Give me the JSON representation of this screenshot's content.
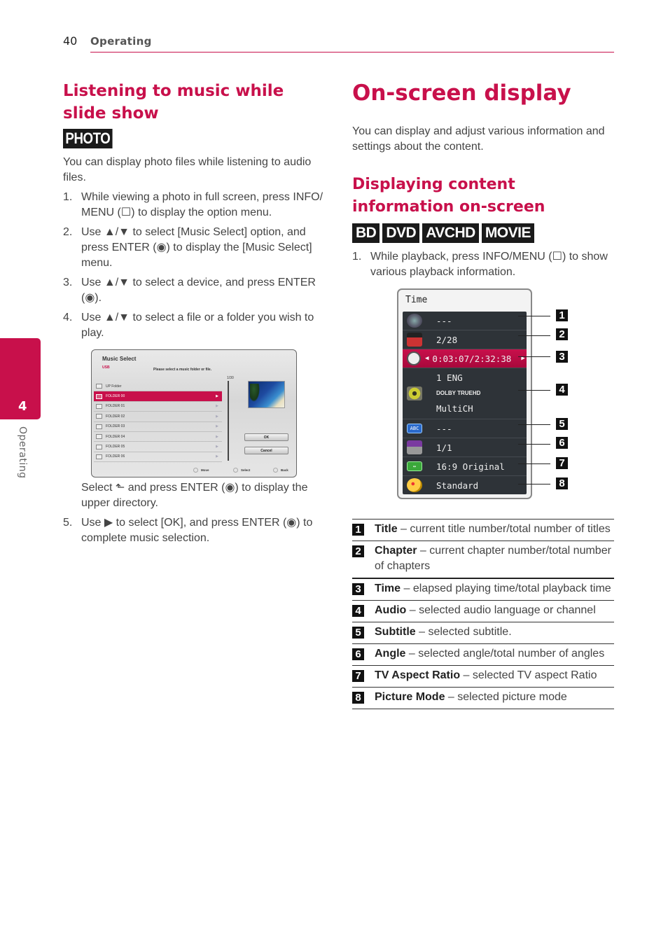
{
  "header": {
    "page_number": "40",
    "section": "Operating"
  },
  "side_tab": {
    "chapter_number": "4",
    "label": "Operating"
  },
  "left": {
    "heading": "Listening to music while slide show",
    "badge": "PHOTO",
    "intro": "You can display photo files while listening to audio files.",
    "steps": [
      {
        "num": "1.",
        "text": "While viewing a photo in full screen, press INFO/ MENU (☐) to display the option menu."
      },
      {
        "num": "2.",
        "text": "Use ▲/▼ to select [Music Select] option, and press ENTER (◉) to display the [Music Select] menu."
      },
      {
        "num": "3.",
        "text": "Use ▲/▼ to select a device, and press ENTER (◉)."
      },
      {
        "num": "4.",
        "text": "Use ▲/▼ to select a file or a folder you wish to play."
      }
    ],
    "upper_dir_note": "Select ⬑ and press ENTER (◉) to display the upper directory.",
    "step5": {
      "num": "5.",
      "text": "Use ▶ to select [OK], and press ENTER (◉) to complete music selection."
    }
  },
  "music_select": {
    "title": "Music Select",
    "device": "USB",
    "prompt": "Please select a music folder or file.",
    "count": "1/30",
    "items": [
      {
        "label": "UP Folder",
        "selected": false
      },
      {
        "label": "FOLDER 00",
        "selected": true
      },
      {
        "label": "FOLDER 01",
        "selected": false
      },
      {
        "label": "FOLDER 02",
        "selected": false
      },
      {
        "label": "FOLDER 03",
        "selected": false
      },
      {
        "label": "FOLDER 04",
        "selected": false
      },
      {
        "label": "FOLDER 05",
        "selected": false
      },
      {
        "label": "FOLDER 06",
        "selected": false
      }
    ],
    "ok_label": "OK",
    "cancel_label": "Cancel",
    "footer": {
      "move": "Move",
      "select": "Select",
      "back": "Back"
    }
  },
  "right": {
    "title": "On-screen display",
    "intro": "You can display and adjust various information and settings about the content.",
    "subheading": "Displaying content information on-screen",
    "badges": [
      "BD",
      "DVD",
      "AVCHD",
      "MOVIE"
    ],
    "step1": {
      "num": "1.",
      "text": "While playback, press INFO/MENU (☐) to show various playback information."
    }
  },
  "osd": {
    "header": "Time",
    "rows": [
      {
        "icon": "film-reel-icon",
        "value": "---"
      },
      {
        "icon": "clapperboard-icon",
        "value": "2/28"
      },
      {
        "icon": "clock-icon",
        "value": "0:03:07/2:32:38",
        "selected": true
      },
      {
        "icon": "speaker-icon",
        "value": "1 ENG",
        "value2": "DOLBY TRUEHD",
        "value3": "MultiCH"
      },
      {
        "icon": "subtitle-abc-icon",
        "value": "---"
      },
      {
        "icon": "camera-angle-icon",
        "value": "1/1"
      },
      {
        "icon": "aspect-ratio-icon",
        "value": "16:9 Original"
      },
      {
        "icon": "palette-icon",
        "value": "Standard"
      }
    ],
    "callouts": [
      "1",
      "2",
      "3",
      "4",
      "5",
      "6",
      "7",
      "8"
    ]
  },
  "legend": [
    {
      "num": "1",
      "term": "Title",
      "desc": " – current title number/total number of titles"
    },
    {
      "num": "2",
      "term": "Chapter",
      "desc": " – current chapter number/total number of chapters"
    },
    {
      "num": "3",
      "term": "Time",
      "desc": " – elapsed playing time/total playback time"
    },
    {
      "num": "4",
      "term": "Audio",
      "desc": " – selected audio language or channel"
    },
    {
      "num": "5",
      "term": "Subtitle",
      "desc": " – selected subtitle."
    },
    {
      "num": "6",
      "term": "Angle",
      "desc": " – selected angle/total number of angles"
    },
    {
      "num": "7",
      "term": "TV Aspect Ratio",
      "desc": " – selected TV aspect Ratio"
    },
    {
      "num": "8",
      "term": "Picture Mode",
      "desc": " – selected picture mode"
    }
  ],
  "colors": {
    "accent": "#c8104b",
    "badge": "#1a1a1a",
    "osd_panel": "#2e3338"
  }
}
